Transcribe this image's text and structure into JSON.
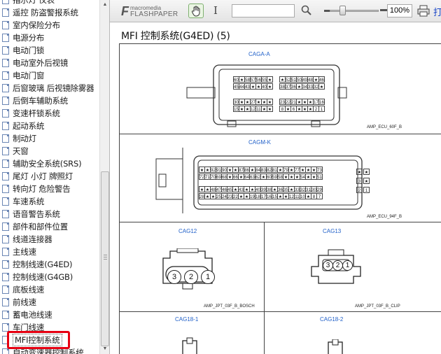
{
  "sidebar": {
    "items": [
      {
        "label": "指示灯 仪表"
      },
      {
        "label": "遥控 防盗警报系统"
      },
      {
        "label": "室内保险分布"
      },
      {
        "label": "电源分布"
      },
      {
        "label": "电动门锁"
      },
      {
        "label": "电动室外后视镜"
      },
      {
        "label": "电动门窗"
      },
      {
        "label": "后窗玻璃 后视镜除雾器"
      },
      {
        "label": "后倒车辅助系统"
      },
      {
        "label": "变速杆锁系统"
      },
      {
        "label": "起动系统"
      },
      {
        "label": "制动灯"
      },
      {
        "label": "天窗"
      },
      {
        "label": "辅助安全系统(SRS)"
      },
      {
        "label": "尾灯 小灯 牌照灯"
      },
      {
        "label": "转向灯 危险警告"
      },
      {
        "label": "车速系统"
      },
      {
        "label": "语音警告系统"
      },
      {
        "label": "部件和部件位置"
      },
      {
        "label": "线道连接器"
      },
      {
        "label": "主线速"
      },
      {
        "label": "控制线速(G4ED)"
      },
      {
        "label": "控制线速(G4GB)"
      },
      {
        "label": "底板线速"
      },
      {
        "label": "前线速"
      },
      {
        "label": "蓄电池线速"
      },
      {
        "label": "车门线速"
      },
      {
        "label": "MFI控制系统",
        "selected": true
      },
      {
        "label": "自动变速器控制系统"
      }
    ]
  },
  "toolbar": {
    "logo_small": "macromedia",
    "logo_big": "FLASHPAPER",
    "search_value": "",
    "zoom": "100%",
    "print_label": "打"
  },
  "document": {
    "title": "MFI 控制系统(G4ED) (5)",
    "connectors": [
      {
        "name": "CAGA-A",
        "part": "AMP_ECU_60F_B",
        "rows": [
          [
            "60",
            "★",
            "58",
            "57",
            "56",
            "55",
            "★",
            "★",
            "52",
            "51",
            "50",
            "49",
            "48",
            "★",
            "46"
          ],
          [
            "45",
            "44",
            "43",
            "★",
            "★",
            "40",
            "★",
            "38",
            "37",
            "36",
            "★",
            "34",
            "33",
            "32",
            "★"
          ],
          [
            "30",
            "★",
            "★",
            "27",
            "★",
            "★",
            "★",
            "23",
            "22",
            "21",
            "★",
            "★",
            "★",
            "17",
            "16"
          ],
          [
            "15",
            "★",
            "★",
            "12",
            "11",
            "★",
            "★",
            "8",
            "★",
            "6",
            "★",
            "★",
            "★",
            "2",
            "1"
          ]
        ]
      },
      {
        "name": "CAGM-K",
        "part": "AMP_ECU_94F_B",
        "rows": [
          [
            "★",
            "★",
            "92",
            "91",
            "90",
            "★",
            "★",
            "87",
            "86",
            "★",
            "84",
            "83",
            "82",
            "81",
            "★",
            "79",
            "★",
            "77",
            "★",
            "★",
            "★",
            "73"
          ],
          [
            "72",
            "71",
            "70",
            "69",
            "68",
            "★",
            "66",
            "★",
            "64",
            "63",
            "62",
            "★",
            "60",
            "59",
            "58",
            "★",
            "★",
            "★",
            "54",
            "★",
            "★",
            "51"
          ],
          [
            "★",
            "★",
            "48",
            "47",
            "46",
            "45",
            "★",
            "43",
            "★",
            "★",
            "40",
            "39",
            "38",
            "★",
            "36",
            "35",
            "★",
            "33",
            "32",
            "31",
            "30",
            "29"
          ],
          [
            "28",
            "★",
            "★",
            "25",
            "24",
            "23",
            "22",
            "★",
            "★",
            "19",
            "18",
            "17",
            "16",
            "15",
            "★",
            "★",
            "12",
            "11",
            "10",
            "★",
            "8",
            "7"
          ]
        ],
        "side_pins": [
          "★",
          "★",
          "3",
          "★",
          "2",
          "1"
        ]
      },
      {
        "name": "CAG12",
        "part": "AMP_JPT_03F_B_BOSCH",
        "pins": [
          "3",
          "2",
          "1"
        ]
      },
      {
        "name": "CAG13",
        "part": "AMP_JPT_03F_B_CLIP",
        "pins": [
          "3",
          "2",
          "1"
        ]
      },
      {
        "name": "CAG18-1",
        "part": "",
        "pins": []
      },
      {
        "name": "CAG18-2",
        "part": "",
        "pins": []
      }
    ]
  },
  "colors": {
    "link": "#1f5fc8",
    "highlight": "#e60012",
    "accent_green": "#7fb070"
  }
}
